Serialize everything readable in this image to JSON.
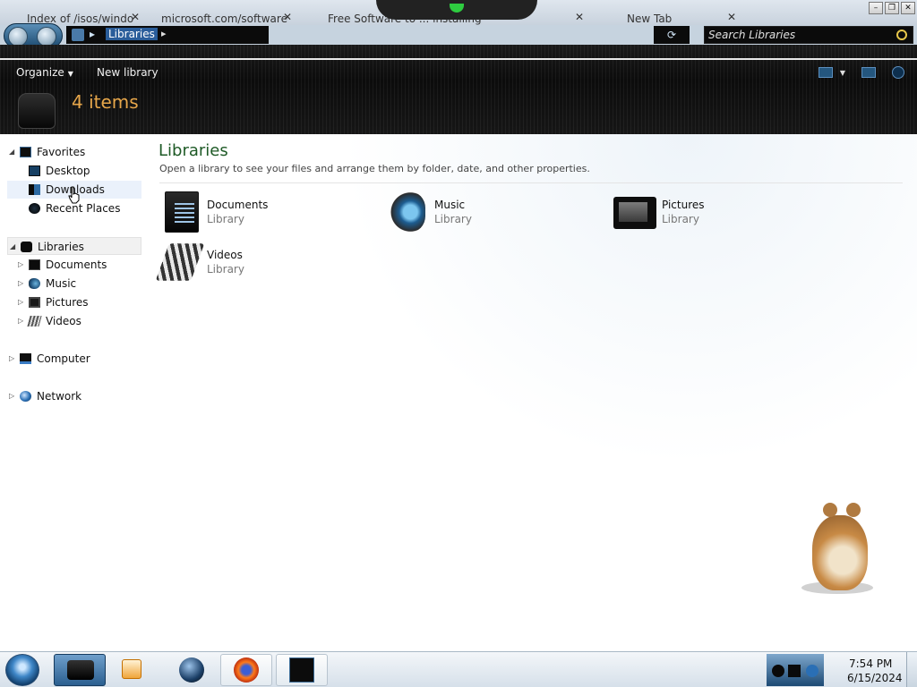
{
  "browser_tabs": [
    {
      "title": "Index of /isos/windo"
    },
    {
      "title": "microsoft.com/software"
    },
    {
      "title": "Free Software to ... installing"
    },
    {
      "title": "New Tab"
    }
  ],
  "window_buttons": {
    "minimize": "–",
    "restore": "❐",
    "close": "✕"
  },
  "address": {
    "separator": "▸",
    "location": "Libraries",
    "dropdown": "▸"
  },
  "search": {
    "placeholder": "Search Libraries",
    "icon": "search-icon"
  },
  "toolbar": {
    "organize": "Organize",
    "new_library": "New library"
  },
  "details": {
    "item_count": "4 items"
  },
  "nav": {
    "favorites": {
      "label": "Favorites",
      "items": [
        "Desktop",
        "Downloads",
        "Recent Places"
      ]
    },
    "libraries": {
      "label": "Libraries",
      "items": [
        "Documents",
        "Music",
        "Pictures",
        "Videos"
      ]
    },
    "computer": {
      "label": "Computer"
    },
    "network": {
      "label": "Network"
    }
  },
  "content": {
    "title": "Libraries",
    "subtitle": "Open a library to see your files and arrange them by folder, date, and other properties.",
    "libraries": [
      {
        "name": "Documents",
        "type": "Library",
        "icon": "documents-library-icon"
      },
      {
        "name": "Music",
        "type": "Library",
        "icon": "music-library-icon"
      },
      {
        "name": "Pictures",
        "type": "Library",
        "icon": "pictures-library-icon"
      },
      {
        "name": "Videos",
        "type": "Library",
        "icon": "videos-library-icon"
      }
    ]
  },
  "taskbar": {
    "apps": [
      "windows-explorer",
      "media-player",
      "browser-globe",
      "firefox",
      "terminal"
    ],
    "clock": {
      "time": "7:54 PM",
      "date": "6/15/2024"
    }
  },
  "colors": {
    "header_bg": "#111111",
    "item_count": "#e6a64a",
    "content_title": "#1e5a26",
    "selection": "#eaf1fb"
  }
}
